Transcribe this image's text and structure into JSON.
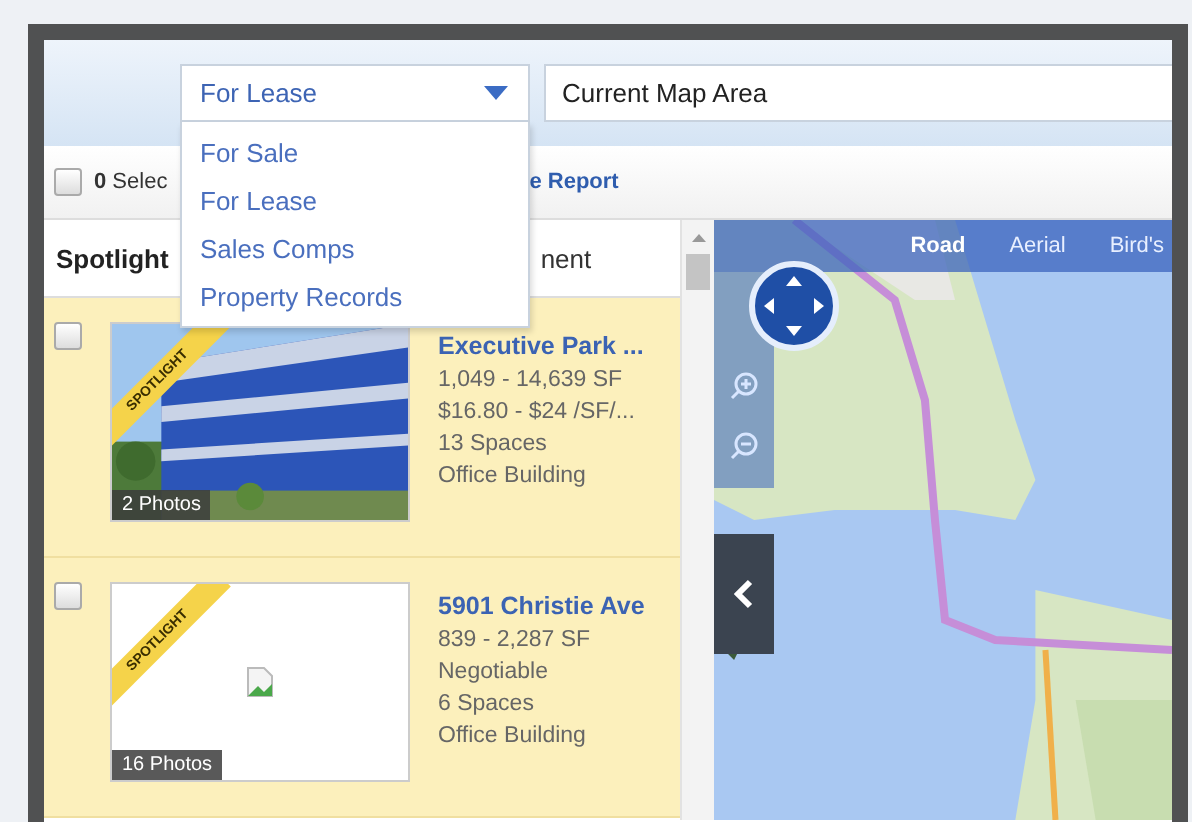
{
  "filter": {
    "value": "For Lease",
    "expanded": true,
    "options": [
      {
        "label": "For Sale"
      },
      {
        "label": "For Lease"
      },
      {
        "label": "Sales Comps"
      },
      {
        "label": "Property Records"
      }
    ]
  },
  "location": {
    "value": "Current Map Area"
  },
  "toolbar": {
    "select_all_checked": false,
    "selected_count": "0",
    "selected_label": "Selec",
    "report_link": "e Report"
  },
  "columns": [
    {
      "label": "Spotlight",
      "kind": "bold"
    },
    {
      "label": "nent",
      "kind": "plain"
    }
  ],
  "listings": [
    {
      "checked": false,
      "spotlight": "SPOTLIGHT",
      "photos": "2 Photos",
      "title": "Executive Park ...",
      "lines": [
        "1,049 - 14,639 SF",
        "$16.80 - $24 /SF/...",
        "13 Spaces",
        "Office Building"
      ]
    },
    {
      "checked": false,
      "spotlight": "SPOTLIGHT",
      "kind": "broken",
      "photos": "16 Photos",
      "title": "5901 Christie Ave",
      "lines": [
        "839 - 2,287 SF",
        "Negotiable",
        "6 Spaces",
        "Office Building"
      ]
    }
  ],
  "map": {
    "kind": "picture",
    "types": [
      {
        "label": "Road",
        "selected": true
      },
      {
        "label": "Aerial",
        "selected": false
      },
      {
        "label": "Bird's",
        "selected": false
      }
    ]
  }
}
